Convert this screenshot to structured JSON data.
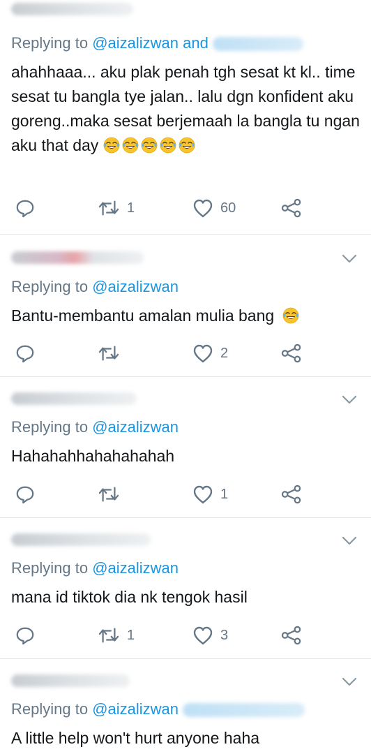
{
  "tweets": [
    {
      "replying_prefix": "Replying to ",
      "handle": "@aizalizwan and",
      "text": "ahahhaaa... aku plak penah tgh sesat kt kl.. time sesat tu bangla tye jalan.. lalu dgn konfident aku goreng..maka sesat berjemaah la bangla tu ngan aku that day",
      "emoji_count": 5,
      "retweets": "1",
      "likes": "60"
    },
    {
      "replying_prefix": "Replying to ",
      "handle": "@aizalizwan",
      "text": "Bantu-membantu amalan mulia bang",
      "emoji_count": 1,
      "retweets": "",
      "likes": "2"
    },
    {
      "replying_prefix": "Replying to ",
      "handle": "@aizalizwan",
      "text": "Hahahahhahahahahah",
      "emoji_count": 0,
      "retweets": "",
      "likes": "1"
    },
    {
      "replying_prefix": "Replying to ",
      "handle": "@aizalizwan",
      "text": "mana id tiktok dia nk tengok hasil",
      "emoji_count": 0,
      "retweets": "1",
      "likes": "3"
    },
    {
      "replying_prefix": "Replying to ",
      "handle": "@aizalizwan",
      "text": "A little help won't hurt anyone haha",
      "emoji_count": 0,
      "retweets": "",
      "likes": ""
    }
  ],
  "icons": {
    "reply": "reply-icon",
    "retweet": "retweet-icon",
    "like": "heart-icon",
    "share": "share-icon",
    "more": "chevron-down-icon",
    "emoji": "face-with-tears-of-joy-emoji"
  },
  "colors": {
    "handle": "#1b95e0",
    "muted": "#657786",
    "text": "#14171a",
    "divider": "#e1e6ea"
  }
}
